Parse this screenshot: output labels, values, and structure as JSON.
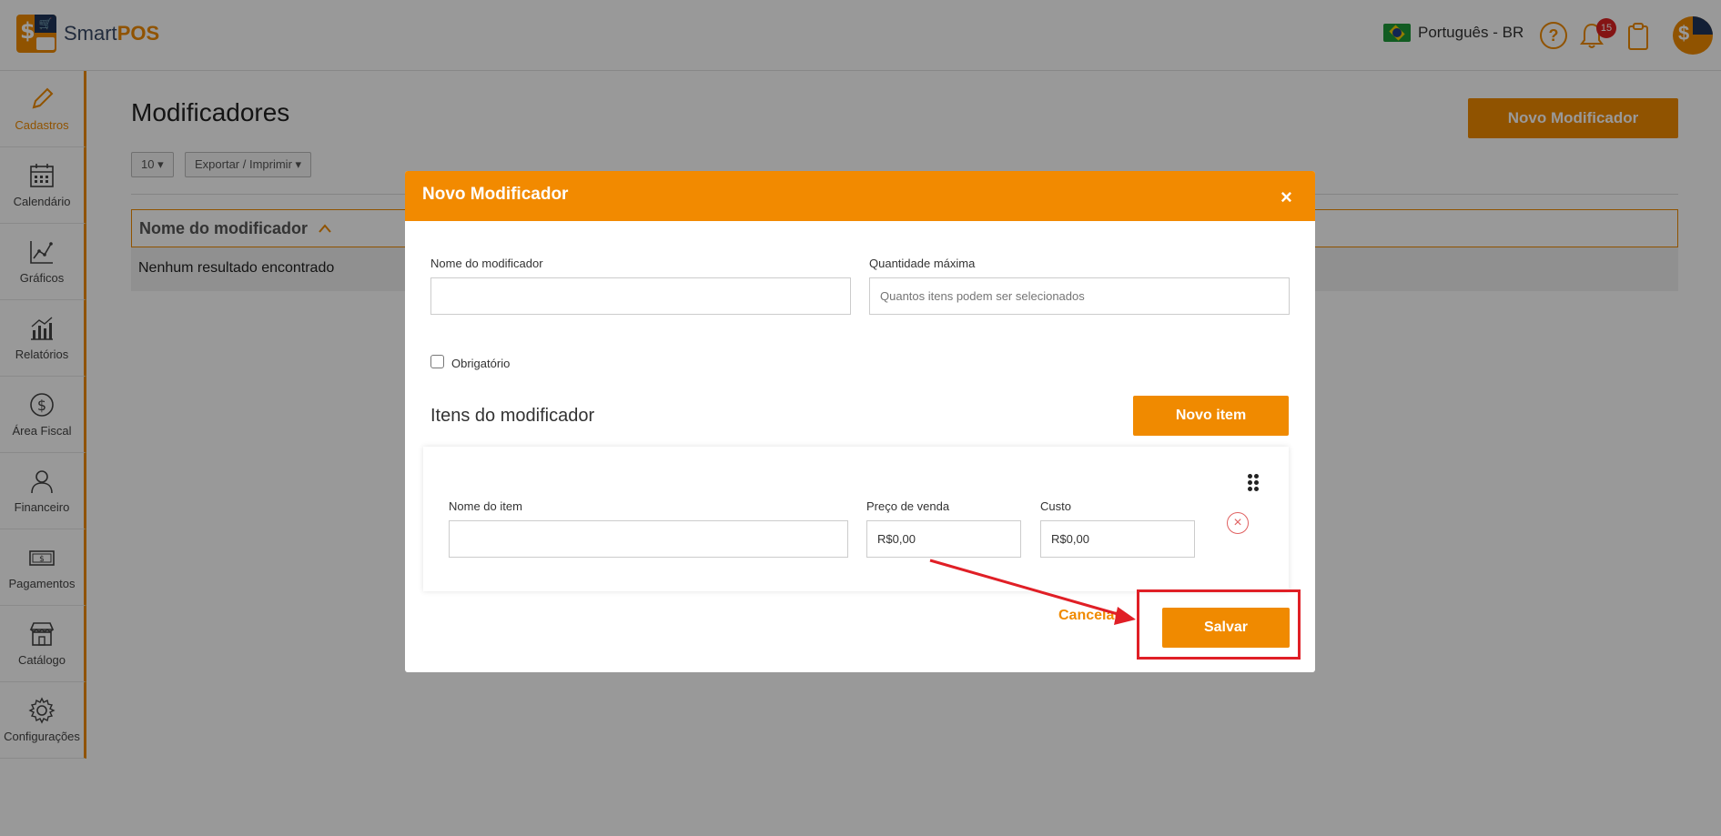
{
  "header": {
    "logo_prefix": "Smart",
    "logo_suffix": "POS",
    "language": "Português - BR",
    "notification_count": "15"
  },
  "sidebar": {
    "items": [
      {
        "label": "Cadastros",
        "icon": "pencil-icon",
        "active": true
      },
      {
        "label": "Calendário",
        "icon": "calendar-icon"
      },
      {
        "label": "Gráficos",
        "icon": "line-chart-icon"
      },
      {
        "label": "Relatórios",
        "icon": "bar-chart-icon"
      },
      {
        "label": "Área Fiscal",
        "icon": "dollar-circle-icon"
      },
      {
        "label": "Financeiro",
        "icon": "person-icon"
      },
      {
        "label": "Pagamentos",
        "icon": "banknote-icon"
      },
      {
        "label": "Catálogo",
        "icon": "store-icon"
      },
      {
        "label": "Configurações",
        "icon": "gear-icon"
      }
    ]
  },
  "main": {
    "title": "Modificadores",
    "new_button": "Novo Modificador",
    "page_size": "10 ▾",
    "export_button": "Exportar / Imprimir ▾",
    "column_header": "Nome do modificador",
    "sort_icon": "chevron-up-icon",
    "empty_message": "Nenhum resultado encontrado"
  },
  "modal": {
    "title": "Novo Modificador",
    "close": "×",
    "name_label": "Nome do modificador",
    "name_value": "",
    "max_qty_label": "Quantidade máxima",
    "max_qty_placeholder": "Quantos itens podem ser selecionados",
    "required_label": "Obrigatório",
    "items_title": "Itens do modificador",
    "new_item_button": "Novo item",
    "item": {
      "name_label": "Nome do item",
      "name_value": "",
      "price_label": "Preço de venda",
      "price_value": "R$0,00",
      "cost_label": "Custo",
      "cost_value": "R$0,00"
    },
    "cancel_button": "Cancelar",
    "save_button": "Salvar"
  },
  "colors": {
    "accent": "#f08a00",
    "annotation": "#e01f26"
  }
}
